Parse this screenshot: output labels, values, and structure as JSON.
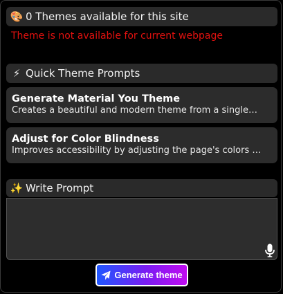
{
  "themes_section": {
    "icon": "palette-icon",
    "icon_glyph": "🎨",
    "title": "0 Themes available for this site",
    "error": "Theme is not available for current webpage"
  },
  "quick_prompts": {
    "icon": "lightning-icon",
    "icon_glyph": "⚡",
    "title": "Quick Theme Prompts",
    "items": [
      {
        "title": "Generate Material You Theme",
        "description": "Creates a beautiful and modern theme from a single…"
      },
      {
        "title": "Adjust for Color Blindness",
        "description": "Improves accessibility by adjusting the page's colors for…"
      }
    ]
  },
  "write_prompt": {
    "icon": "sparkles-icon",
    "icon_glyph": "✨",
    "title": "Write Prompt",
    "value": "",
    "placeholder": ""
  },
  "generate_button": {
    "icon": "send-icon",
    "label": "Generate theme"
  },
  "colors": {
    "background": "#000000",
    "panel": "#2a2a2a",
    "error": "#e0110f",
    "button_gradient_start": "#1f57ff",
    "button_gradient_end": "#c00cf0"
  }
}
